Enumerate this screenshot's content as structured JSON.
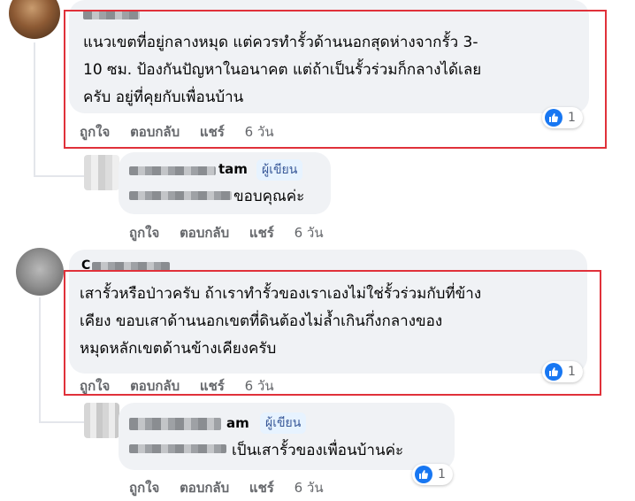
{
  "comments": [
    {
      "lines": [
        "แนวเขตที่อยู่กลางหมุด แต่ควรทำรั้วด้านนอกสุดห่างจากรั้ว 3-",
        "10 ซม. ป้องกันปัญหาในอนาคต แต่ถ้าเป็นรั้วร่วมก็กลางได้เลย",
        "ครับ อยู่ที่คุยกับเพื่อนบ้าน"
      ],
      "actions": {
        "like": "ถูกใจ",
        "reply": "ตอบกลับ",
        "share": "แชร์",
        "time": "6 วัน"
      },
      "reaction_count": "1"
    },
    {
      "name_initial": "C",
      "lines": [
        "เสารั้วหรือป่าวครับ ถ้าเราทำรั้วของเราเองไม่ใช่รั้วร่วมกับที่ข้าง",
        "เคียง ขอบเสาด้านนอกเขตที่ดินต้องไม่ล้ำเกินกึ่งกลางของ",
        "หมุดหลักเขตด้านข้างเคียงครับ"
      ],
      "actions": {
        "like": "ถูกใจ",
        "reply": "ตอบกลับ",
        "share": "แชร์",
        "time": "6 วัน"
      },
      "reaction_count": "1"
    }
  ],
  "replies": [
    {
      "name_suffix": "tam",
      "badge": "ผู้เขียน",
      "text": "ขอบคุณค่ะ",
      "actions": {
        "like": "ถูกใจ",
        "reply": "ตอบกลับ",
        "share": "แชร์",
        "time": "6 วัน"
      }
    },
    {
      "name_suffix": "am",
      "badge": "ผู้เขียน",
      "text": "เป็นเสารั้วของเพื่อนบ้านค่ะ",
      "actions": {
        "like": "ถูกใจ",
        "reply": "ตอบกลับ",
        "share": "แชร์",
        "time": "6 วัน"
      },
      "reaction_count": "1"
    }
  ],
  "colors": {
    "highlight": "#e0313a",
    "like_blue": "#1877f2",
    "bubble": "#f0f2f5",
    "meta": "#65676b"
  }
}
